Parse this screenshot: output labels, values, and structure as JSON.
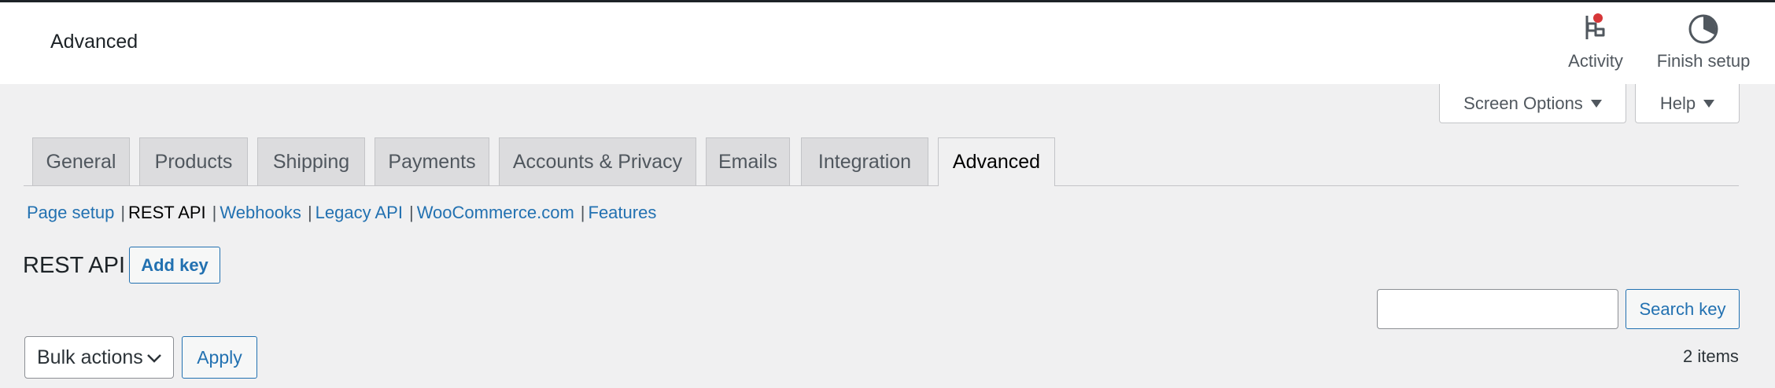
{
  "header": {
    "title": "Advanced",
    "activity_label": "Activity",
    "finish_setup_label": "Finish setup",
    "notification_color": "#d63638"
  },
  "screen_meta": {
    "screen_options_label": "Screen Options",
    "help_label": "Help"
  },
  "tabs": [
    {
      "label": "General"
    },
    {
      "label": "Products"
    },
    {
      "label": "Shipping"
    },
    {
      "label": "Payments"
    },
    {
      "label": "Accounts & Privacy"
    },
    {
      "label": "Emails"
    },
    {
      "label": "Integration"
    },
    {
      "label": "Advanced",
      "active": true
    }
  ],
  "subnav": [
    {
      "label": "Page setup"
    },
    {
      "label": "REST API",
      "current": true
    },
    {
      "label": "Webhooks"
    },
    {
      "label": "Legacy API"
    },
    {
      "label": "WooCommerce.com"
    },
    {
      "label": "Features"
    }
  ],
  "main": {
    "heading": "REST API",
    "add_key_label": "Add key",
    "search": {
      "value": "",
      "placeholder": ""
    },
    "search_button_label": "Search key",
    "bulk_actions_label": "Bulk actions",
    "apply_label": "Apply",
    "items_count": "2 items"
  },
  "colors": {
    "accent": "#2271b1",
    "background": "#f0f0f1"
  }
}
